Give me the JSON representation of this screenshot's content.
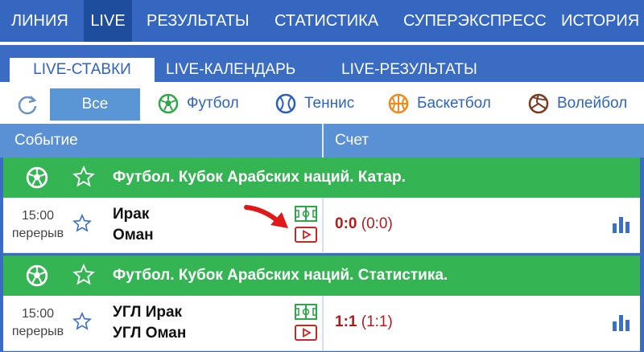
{
  "top_nav": {
    "items": [
      {
        "label": "ЛИНИЯ",
        "active": false
      },
      {
        "label": "LIVE",
        "active": true
      },
      {
        "label": "РЕЗУЛЬТАТЫ",
        "active": false
      },
      {
        "label": "СТАТИСТИКА",
        "active": false
      },
      {
        "label": "СУПЕРЭКСПРЕСС",
        "active": false
      },
      {
        "label": "ИСТОРИЯ",
        "active": false
      }
    ]
  },
  "sub_tabs": [
    {
      "label": "LIVE-СТАВКИ",
      "active": true
    },
    {
      "label": "LIVE-КАЛЕНДАРЬ",
      "active": false
    },
    {
      "label": "LIVE-РЕЗУЛЬТАТЫ",
      "active": false
    }
  ],
  "filters": {
    "all_label": "Все",
    "sports": [
      {
        "label": "Футбол",
        "icon": "soccer-ball-icon"
      },
      {
        "label": "Теннис",
        "icon": "tennis-ball-icon"
      },
      {
        "label": "Баскетбол",
        "icon": "basketball-icon"
      },
      {
        "label": "Волейбол",
        "icon": "volleyball-icon"
      }
    ]
  },
  "columns": {
    "event": "Событие",
    "score": "Счет"
  },
  "leagues": [
    {
      "title": "Футбол. Кубок Арабских наций. Катар.",
      "event": {
        "time": "15:00",
        "status": "перерыв",
        "team1": "Ирак",
        "team2": "Оман",
        "score": "0:0",
        "half_score": "(0:0)"
      }
    },
    {
      "title": "Футбол. Кубок Арабских наций. Статистика.",
      "event": {
        "time": "15:00",
        "status": "перерыв",
        "team1": "УГЛ Ирак",
        "team2": "УГЛ Оман",
        "score": "1:1",
        "half_score": "(1:1)"
      }
    }
  ],
  "colors": {
    "nav_blue": "#3567c1",
    "league_green": "#35b454",
    "score_red": "#b21b1b",
    "column_header": "#5a90d4"
  }
}
